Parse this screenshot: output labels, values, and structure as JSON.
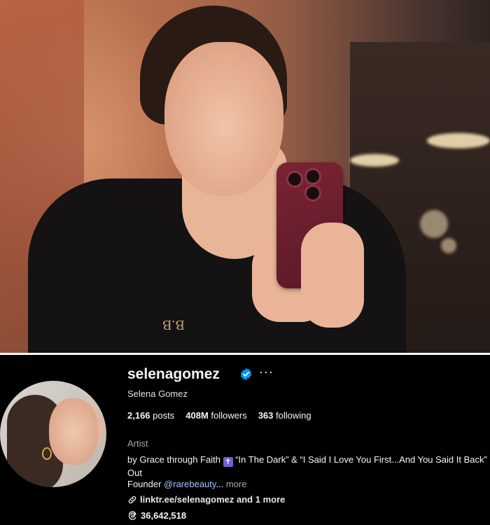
{
  "profile": {
    "username": "selenagomez",
    "full_name": "Selena Gomez",
    "more_label": "···",
    "stats": {
      "posts_count": "2,166",
      "posts_label": "posts",
      "followers_count": "408M",
      "followers_label": "followers",
      "following_count": "363",
      "following_label": "following"
    },
    "category": "Artist",
    "bio_line1_prefix": "by Grace through Faith",
    "bio_line1_suffix": "“In The Dark” & “I Said I Love You First...And You Said It Back” Out",
    "founder_prefix": "Founder",
    "founder_mention": "@rarebeauty",
    "founder_ellipsis": "...",
    "more_link": "more",
    "link_text": "linktr.ee/selenagomez and 1 more",
    "threads_count": "36,642,518"
  },
  "icons": {
    "verified": "verified-badge-icon",
    "link": "link-icon",
    "threads": "threads-icon",
    "cross": "latin-cross-emoji"
  },
  "colors": {
    "background": "#000000",
    "text": "#f5f5f5",
    "secondary_text": "#a8a8a8",
    "mention": "#a7c4ff",
    "verified": "#0095f6"
  }
}
